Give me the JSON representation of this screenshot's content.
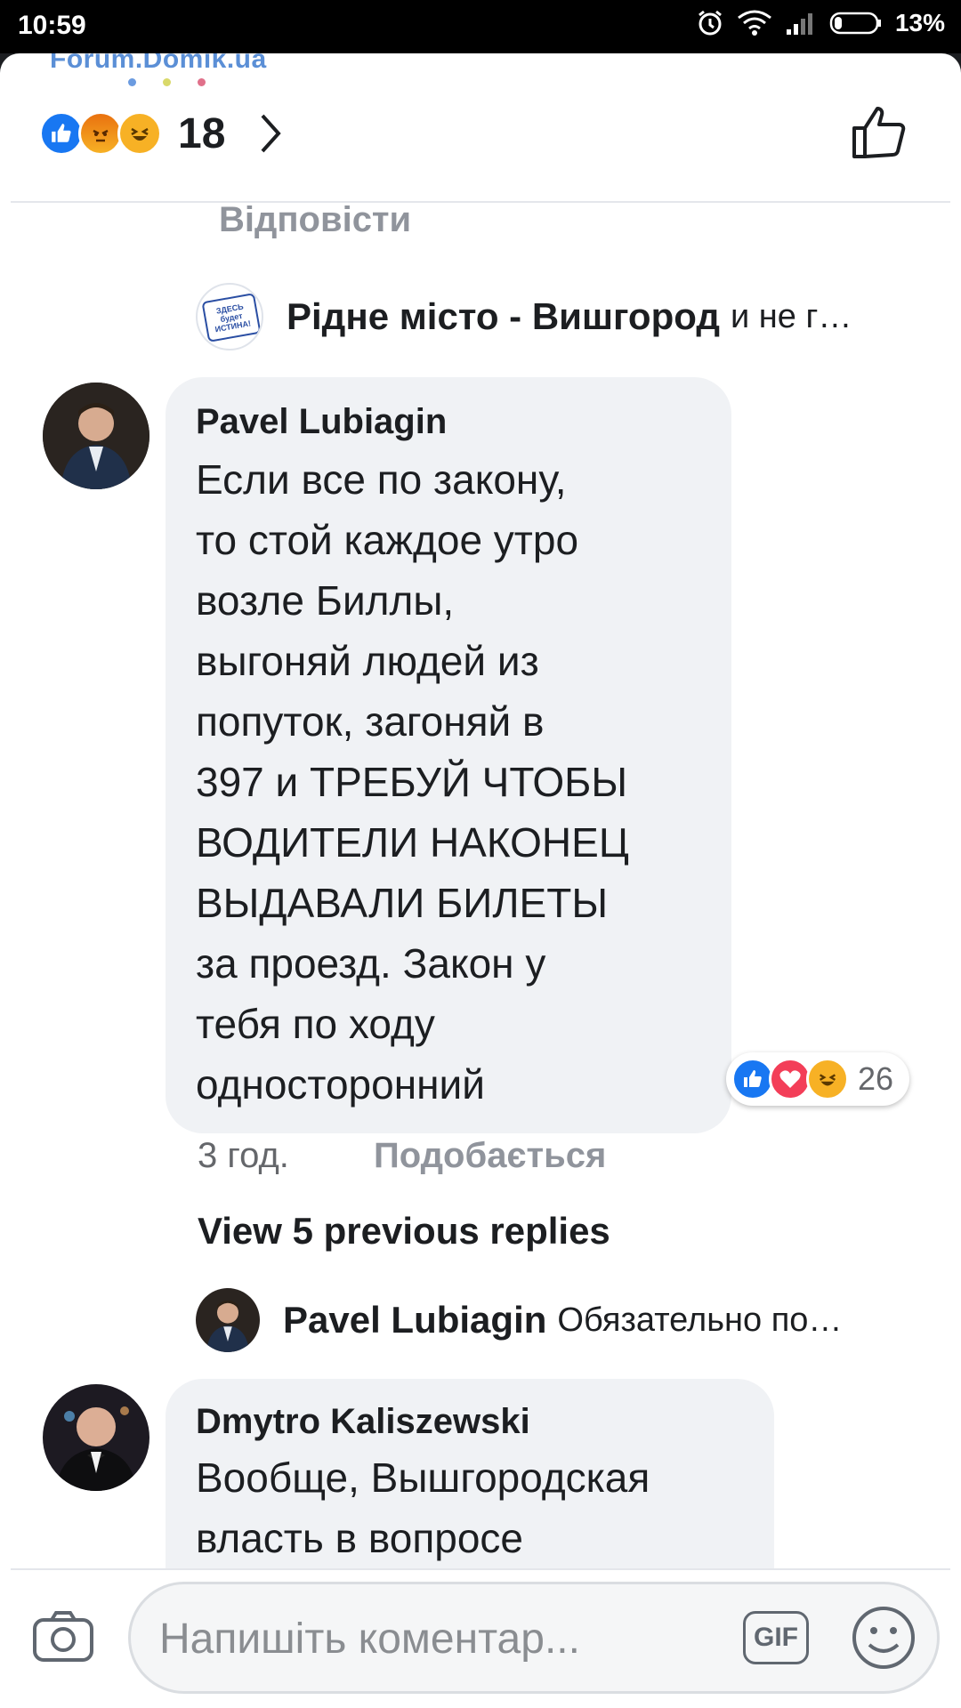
{
  "status_bar": {
    "time": "10:59",
    "battery": "13%"
  },
  "watermark": {
    "text": "Forum.Domik.ua"
  },
  "post_reactions": {
    "icons": [
      "like-icon",
      "angry-icon",
      "haha-icon"
    ],
    "count": "18"
  },
  "previous": {
    "reply_link": "Відповісти"
  },
  "page_reply": {
    "name": "Рідне місто - Вишгород",
    "snippet": "и не г…",
    "avatar_text": "ЗДЕСЬ будет установлена ИСТИНА!"
  },
  "comment1": {
    "author": "Pavel Lubiagin",
    "lines": [
      "Если все по закону,",
      "то стой каждое утро",
      "возле Биллы,",
      "выгоняй людей из",
      "попуток, загоняй в",
      "397 и ТРЕБУЙ ЧТОБЫ",
      "ВОДИТЕЛИ НАКОНЕЦ",
      "ВЫДАВАЛИ БИЛЕТЫ",
      "за проезд. Закон у",
      "тебя по ходу",
      "односторонний"
    ],
    "reactions": {
      "icons": [
        "like-icon",
        "love-icon",
        "haha-icon"
      ],
      "count": "26"
    },
    "time": "3 год.",
    "like_label": "Подобається"
  },
  "view_previous": "View 5 previous replies",
  "reply": {
    "name": "Pavel Lubiagin",
    "snippet": "Обязательно по…"
  },
  "comment2": {
    "author": "Dmytro Kaliszewski",
    "lines": [
      "Вообще, Вышгородская",
      "власть в вопросе"
    ]
  },
  "composer": {
    "placeholder": "Напишіть коментар...",
    "gif_label": "GIF"
  },
  "colors": {
    "like_blue": "#1877f2",
    "love_red": "#f33e58",
    "haha_yellow": "#f7b125",
    "angry_orange": "#e9710f"
  }
}
